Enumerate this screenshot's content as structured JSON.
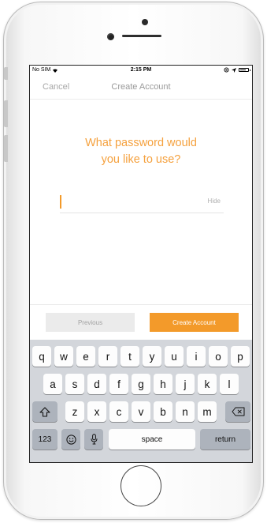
{
  "status_bar": {
    "carrier": "No SIM",
    "time": "2:15 PM",
    "signal_icon": "wifi-icon",
    "right_icons": [
      "rotation-lock-icon",
      "location-arrow-icon",
      "battery-icon"
    ]
  },
  "nav": {
    "cancel_label": "Cancel",
    "title": "Create Account"
  },
  "prompt": {
    "line1": "What password would",
    "line2": "you like to use?"
  },
  "password_field": {
    "value": "",
    "placeholder": "",
    "toggle_label": "Hide"
  },
  "buttons": {
    "previous_label": "Previous",
    "create_label": "Create Account"
  },
  "keyboard": {
    "row1": [
      "q",
      "w",
      "e",
      "r",
      "t",
      "y",
      "u",
      "i",
      "o",
      "p"
    ],
    "row2": [
      "a",
      "s",
      "d",
      "f",
      "g",
      "h",
      "j",
      "k",
      "l"
    ],
    "row3": [
      "z",
      "x",
      "c",
      "v",
      "b",
      "n",
      "m"
    ],
    "numbers_label": "123",
    "space_label": "space",
    "return_label": "return"
  },
  "colors": {
    "accent": "#f39a2a",
    "prompt_text": "#f5a13e",
    "keyboard_bg": "#d3d6db",
    "key_dark": "#adb3bc"
  }
}
